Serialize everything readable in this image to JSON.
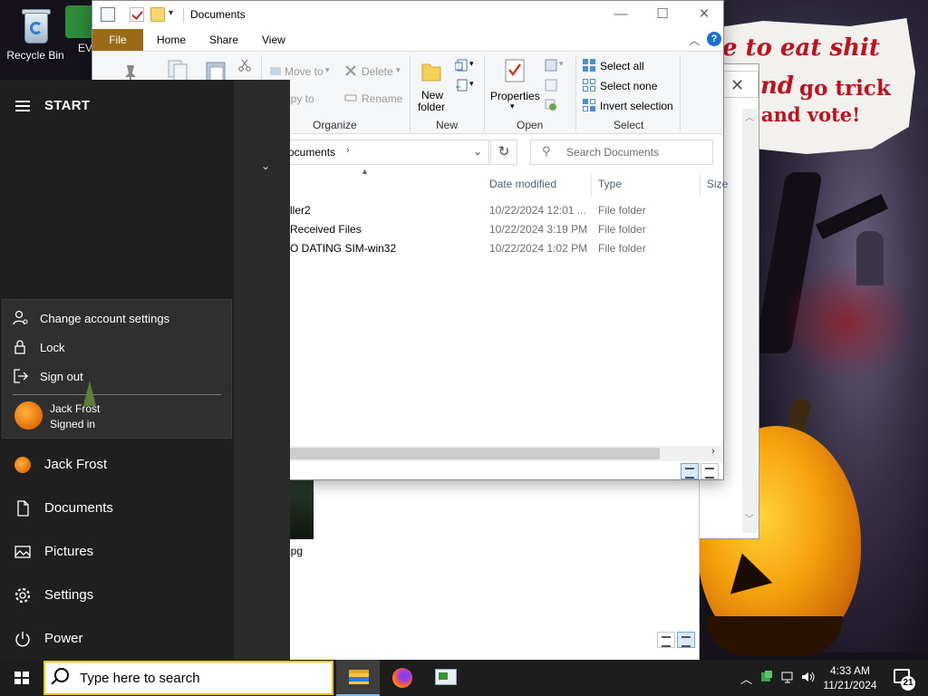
{
  "desktop": {
    "icons": [
      {
        "label": "Recycle Bin"
      },
      {
        "label": "EV"
      }
    ],
    "wallpaper_text": {
      "line1": "e to eat shit",
      "line2": "nd",
      "line3": "go trick",
      "line4": "and vote!"
    },
    "partial_file_label": "jpg"
  },
  "explorer": {
    "title": "Documents",
    "window_buttons": {
      "minimize": "—",
      "maximize": "☐",
      "close": "✕"
    },
    "menu": {
      "file": "File",
      "home": "Home",
      "share": "Share",
      "view": "View"
    },
    "ribbon": {
      "move_to": "Move to",
      "copy_to": "opy to",
      "delete": "Delete",
      "rename": "Rename",
      "organize": "Organize",
      "new_folder_line1": "New",
      "new_folder_line2": "folder",
      "new": "New",
      "properties": "Properties",
      "open": "Open",
      "select_all": "Select all",
      "select_none": "Select none",
      "invert_selection": "Invert selection",
      "select": "Select"
    },
    "address": {
      "path": "ocuments",
      "separator": "›"
    },
    "search": {
      "placeholder": "Search Documents"
    },
    "columns": {
      "date": "Date modified",
      "type": "Type",
      "size": "Size"
    },
    "rows": [
      {
        "name": "ller2",
        "date": "10/22/2024 12:01 ...",
        "type": "File folder"
      },
      {
        "name": "Received Files",
        "date": "10/22/2024 3:19 PM",
        "type": "File folder"
      },
      {
        "name": "O DATING SIM-win32",
        "date": "10/22/2024 1:02 PM",
        "type": "File folder"
      }
    ]
  },
  "start_menu": {
    "title": "START",
    "account_popup": {
      "change_account": "Change account settings",
      "lock": "Lock",
      "sign_out": "Sign out",
      "user_name": "Jack Frost",
      "user_status": "Signed in"
    },
    "nav": [
      {
        "label": "Jack Frost",
        "icon": "user-avatar"
      },
      {
        "label": "Documents",
        "icon": "document-icon"
      },
      {
        "label": "Pictures",
        "icon": "pictures-icon"
      },
      {
        "label": "Settings",
        "icon": "gear-icon"
      },
      {
        "label": "Power",
        "icon": "power-icon"
      }
    ]
  },
  "taskbar": {
    "search_placeholder": "Type here to search",
    "time": "4:33 AM",
    "date": "11/21/2024",
    "notification_count": "21"
  },
  "colors": {
    "file_tab": "#996a17",
    "start_bg": "#2b2b2b",
    "taskbar_bg": "#1d1d1d",
    "accent": "#76b9ed"
  }
}
